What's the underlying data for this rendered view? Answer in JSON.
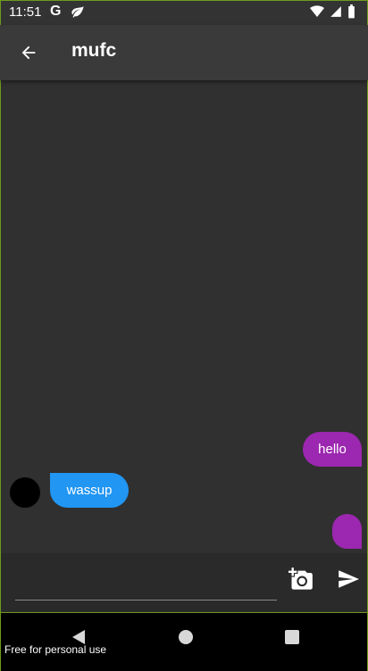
{
  "status_bar": {
    "time": "11:51",
    "g_icon": "G",
    "icons": [
      "google-g-icon",
      "leaf-icon",
      "wifi-icon",
      "cell-signal-icon",
      "battery-icon"
    ]
  },
  "app_bar": {
    "title": "mufc",
    "back_icon": "arrow-left-icon"
  },
  "messages": [
    {
      "text": "hello",
      "sender": "me",
      "color": "#9c27b0"
    },
    {
      "text": "wassup",
      "sender": "other",
      "color": "#2196f3"
    },
    {
      "text": "",
      "sender": "me",
      "color": "#9c27b0"
    }
  ],
  "input": {
    "value": "",
    "placeholder": ""
  },
  "actions": {
    "camera_icon": "add-photo-camera-icon",
    "send_icon": "send-icon"
  },
  "nav_bar": {
    "watermark": "Free for personal use"
  },
  "colors": {
    "chat_background": "#303030",
    "app_bar": "#3a3a3a",
    "my_bubble": "#9c27b0",
    "their_bubble": "#2196f3"
  }
}
